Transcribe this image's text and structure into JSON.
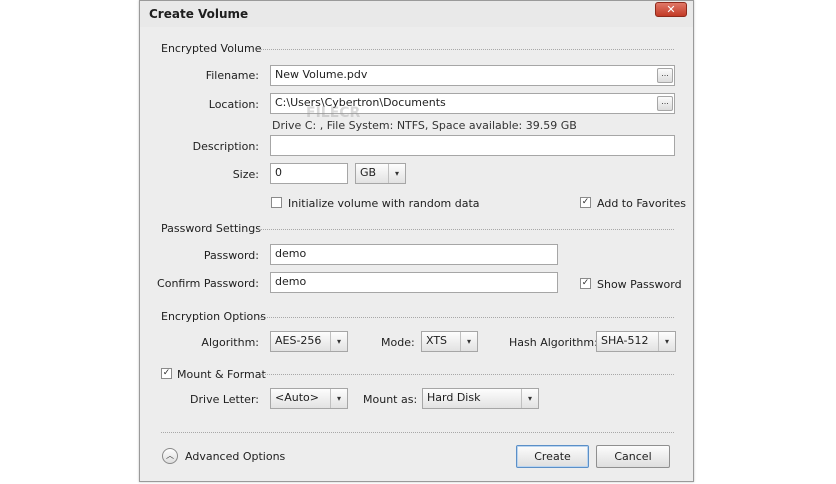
{
  "window": {
    "title": "Create Volume",
    "close_glyph": "✕"
  },
  "encrypted_volume": {
    "section_title": "Encrypted Volume",
    "filename_label": "Filename:",
    "filename_value": "New Volume.pdv",
    "location_label": "Location:",
    "location_value": "C:\\Users\\Cybertron\\Documents",
    "drive_info": "Drive C: , File System: NTFS, Space available: 39.59 GB",
    "description_label": "Description:",
    "description_value": "",
    "size_label": "Size:",
    "size_value": "0",
    "size_unit": "GB",
    "init_random_label": "Initialize volume with random data",
    "init_random_checked": false,
    "add_favorites_label": "Add to Favorites",
    "add_favorites_checked": true,
    "browse_glyph": "..."
  },
  "password_settings": {
    "section_title": "Password Settings",
    "password_label": "Password:",
    "password_value": "demo",
    "confirm_label": "Confirm Password:",
    "confirm_value": "demo",
    "show_password_label": "Show Password",
    "show_password_checked": true
  },
  "encryption_options": {
    "section_title": "Encryption Options",
    "algorithm_label": "Algorithm:",
    "algorithm_value": "AES-256",
    "mode_label": "Mode:",
    "mode_value": "XTS",
    "hash_label": "Hash Algorithm:",
    "hash_value": "SHA-512"
  },
  "mount_format": {
    "section_title": "Mount & Format",
    "checked": true,
    "drive_letter_label": "Drive Letter:",
    "drive_letter_value": "<Auto>",
    "mount_as_label": "Mount as:",
    "mount_as_value": "Hard Disk"
  },
  "footer": {
    "advanced_label": "Advanced Options",
    "create_label": "Create",
    "cancel_label": "Cancel"
  },
  "icons": {
    "checkmark": "✓",
    "dropdown": "▾",
    "chevron_up": "︿"
  },
  "watermark": "FILECR"
}
